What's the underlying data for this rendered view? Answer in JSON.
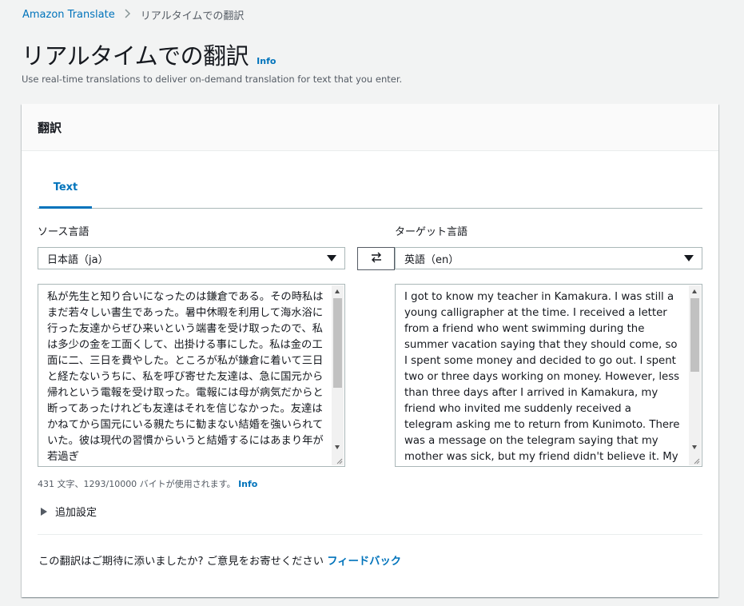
{
  "breadcrumb": {
    "root": "Amazon Translate",
    "current": "リアルタイムでの翻訳"
  },
  "page": {
    "title": "リアルタイムでの翻訳",
    "info": "Info",
    "description": "Use real-time translations to deliver on-demand translation for text that you enter."
  },
  "panel": {
    "header": "翻訳",
    "tabs": [
      {
        "label": "Text",
        "active": true
      }
    ],
    "source": {
      "label": "ソース言語",
      "selected": "日本語（ja）",
      "text": "私が先生と知り合いになったのは鎌倉である。その時私はまだ若々しい書生であった。暑中休暇を利用して海水浴に行った友達からぜひ来いという端書を受け取ったので、私は多少の金を工面くして、出掛ける事にした。私は金の工面に二、三日を費やした。ところが私が鎌倉に着いて三日と経たないうちに、私を呼び寄せた友達は、急に国元から帰れという電報を受け取った。電報には母が病気だからと断ってあったけれども友達はそれを信じなかった。友達はかねてから国元にいる親たちに勧まない結婚を強いられていた。彼は現代の習慣からいうと結婚するにはあまり年が若過ぎ"
    },
    "swap_icon": "swap-arrows-icon",
    "target": {
      "label": "ターゲット言語",
      "selected": "英語（en）",
      "text": "I got to know my teacher in Kamakura. I was still a young calligrapher at the time. I received a letter from a friend who went swimming during the summer vacation saying that they should come, so I spent some money and decided to go out. I spent two or three days working on money. However, less than three days after I arrived in Kamakura, my friend who invited me suddenly received a telegram asking me to return from Kunimoto. There was a message on the telegram saying that my mother was sick, but my friend didn't believe it. My friend had been forced to"
    },
    "count": {
      "text": "431 文字、1293/10000 バイトが使用されます。",
      "info": "Info"
    },
    "additional_settings": "追加設定",
    "feedback": {
      "prompt": "この翻訳はご期待に添いましたか? ご意見をお寄せください",
      "link": "フィードバック"
    }
  },
  "colors": {
    "link": "#0073bb",
    "background": "#f2f3f3",
    "border": "#aab7b8"
  }
}
